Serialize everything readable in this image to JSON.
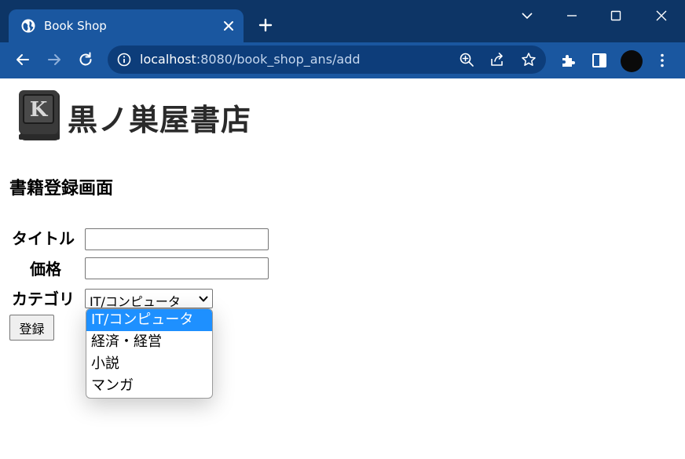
{
  "browser": {
    "tab_title": "Book Shop",
    "url_host": "localhost",
    "url_path": ":8080/book_shop_ans/add"
  },
  "page": {
    "logo_text": "黒ノ巣屋書店",
    "logo_letter": "K",
    "heading": "書籍登録画面",
    "form": {
      "title_label": "タイトル",
      "title_value": "",
      "price_label": "価格",
      "price_value": "",
      "category_label": "カテゴリ",
      "category_selected": "IT/コンピュータ",
      "submit_label": "登録"
    },
    "dropdown": {
      "options": [
        {
          "label": "IT/コンピュータ",
          "selected": true
        },
        {
          "label": "経済・経営",
          "selected": false
        },
        {
          "label": "小説",
          "selected": false
        },
        {
          "label": "マンガ",
          "selected": false
        }
      ]
    }
  },
  "colors": {
    "chrome_dark": "#0d3566",
    "chrome_tab": "#1a57a0",
    "option_highlight": "#1e90ff"
  }
}
